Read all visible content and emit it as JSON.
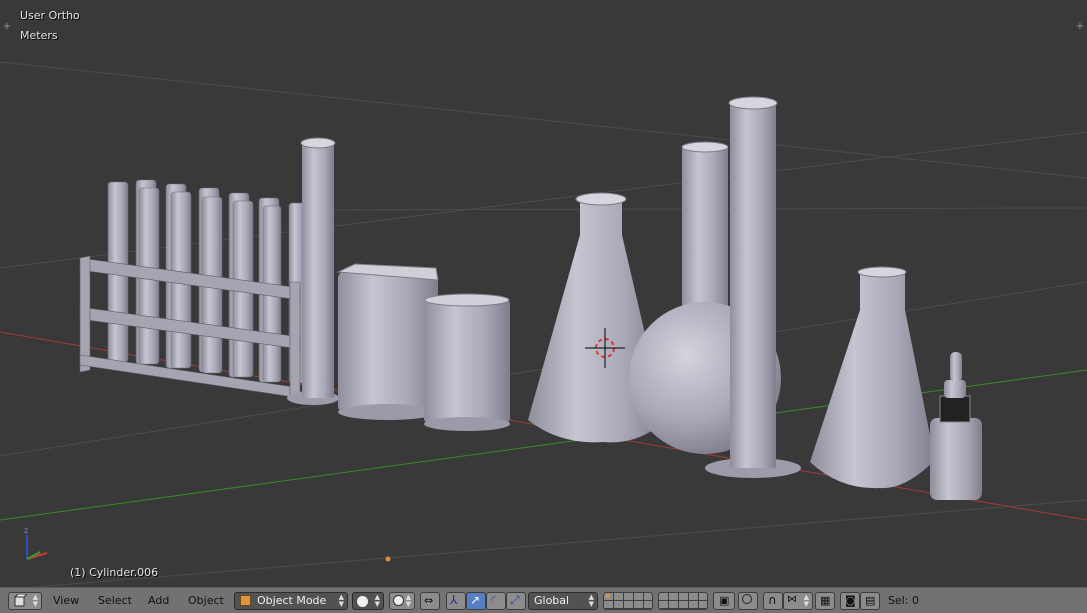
{
  "viewport": {
    "view_name": "User Ortho",
    "units": "Meters",
    "active_object_info": "(1) Cylinder.006",
    "axis_label_z": "z",
    "colors": {
      "background": "#393939",
      "grid": "#4a4a4a",
      "x_axis": "#a33a3a",
      "y_axis": "#3a8a2a",
      "object": "#b4b4c2"
    }
  },
  "header": {
    "editor_icon": "3d-view-icon",
    "menus": [
      "View",
      "Select",
      "Add",
      "Object"
    ],
    "mode_label": "Object Mode",
    "pivot_icon": "sphere-icon",
    "transform_orientation": "Global",
    "selection_info": "Sel: 0",
    "colors": {
      "bar": "#727272",
      "dropdown": "#525252",
      "active": "#5680c2"
    }
  }
}
